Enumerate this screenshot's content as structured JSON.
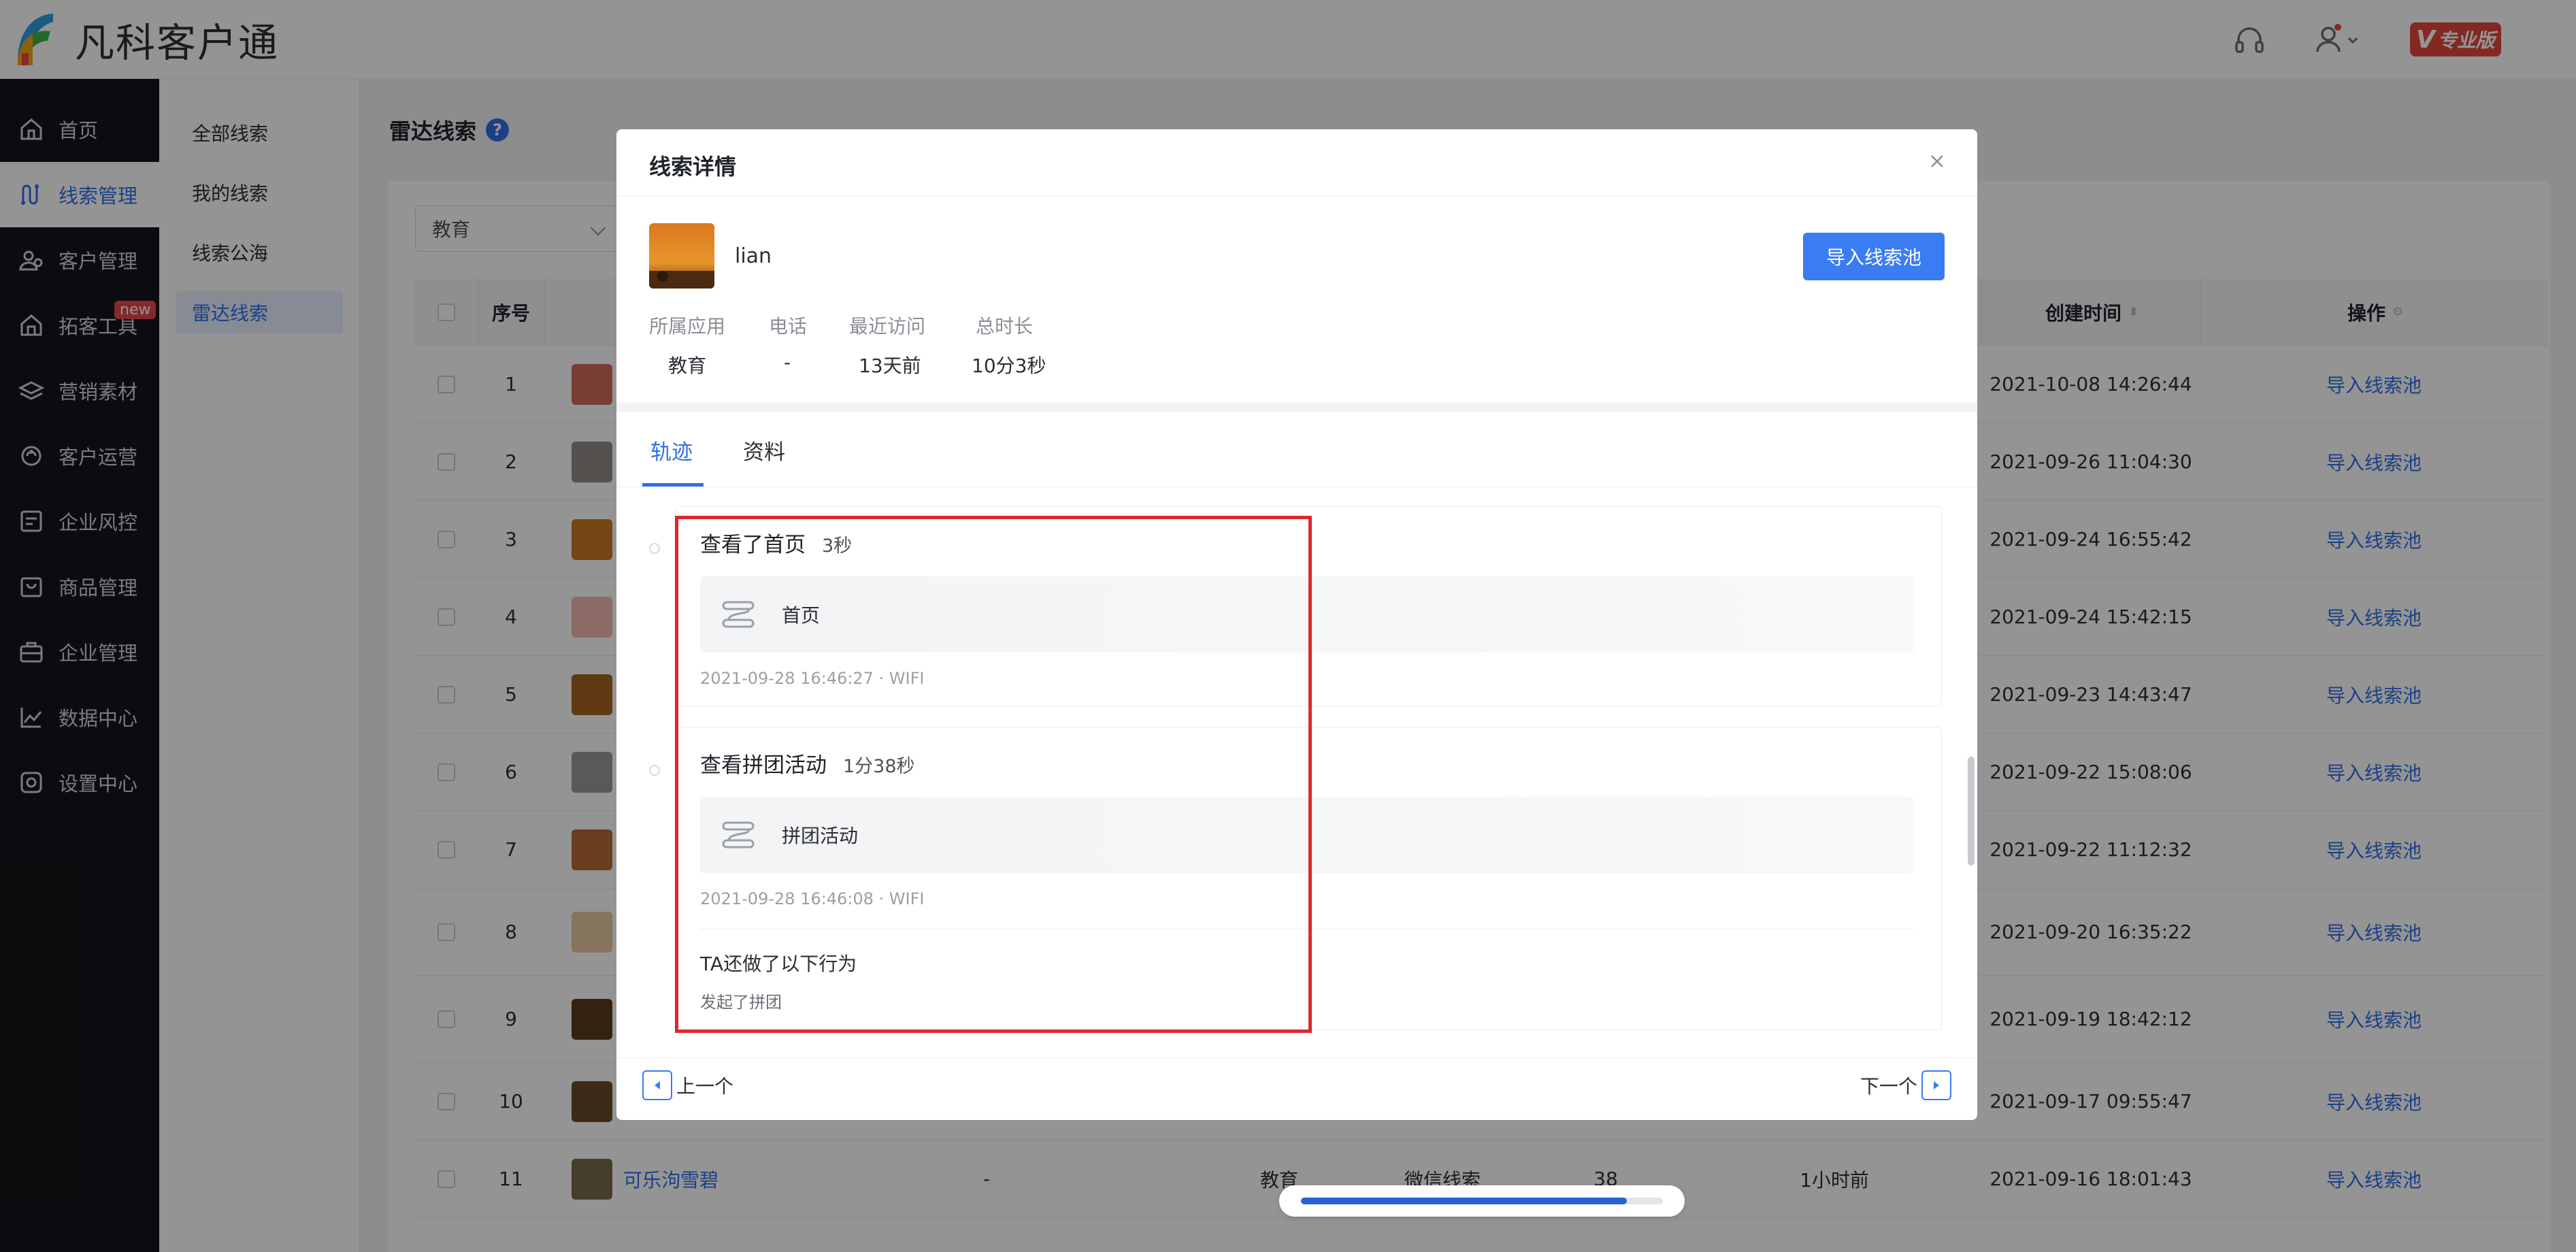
{
  "app": {
    "name": "凡科客户通",
    "edition_label": "专业版",
    "edition_letter": "V"
  },
  "sidebar": {
    "items": [
      {
        "label": "首页",
        "icon": "home-icon"
      },
      {
        "label": "线索管理",
        "icon": "leads-icon",
        "active": true
      },
      {
        "label": "客户管理",
        "icon": "customers-icon"
      },
      {
        "label": "拓客工具",
        "icon": "tools-icon",
        "badge": "new"
      },
      {
        "label": "营销素材",
        "icon": "materials-icon"
      },
      {
        "label": "客户运营",
        "icon": "operations-icon"
      },
      {
        "label": "企业风控",
        "icon": "risk-icon"
      },
      {
        "label": "商品管理",
        "icon": "products-icon"
      },
      {
        "label": "企业管理",
        "icon": "enterprise-icon"
      },
      {
        "label": "数据中心",
        "icon": "data-icon"
      },
      {
        "label": "设置中心",
        "icon": "settings-icon"
      }
    ]
  },
  "submenu": {
    "items": [
      {
        "label": "全部线索"
      },
      {
        "label": "我的线索"
      },
      {
        "label": "线索公海"
      },
      {
        "label": "雷达线索",
        "active": true
      }
    ]
  },
  "main": {
    "title": "雷达线索",
    "filter_value": "教育",
    "table": {
      "headers": {
        "index": "序号",
        "created": "创建时间",
        "actions": "操作"
      },
      "rows": [
        {
          "index": "1",
          "created": "2021-10-08 14:26:44",
          "action": "导入线索池"
        },
        {
          "index": "2",
          "created": "2021-09-26 11:04:30",
          "action": "导入线索池"
        },
        {
          "index": "3",
          "created": "2021-09-24 16:55:42",
          "action": "导入线索池"
        },
        {
          "index": "4",
          "created": "2021-09-24 15:42:15",
          "action": "导入线索池"
        },
        {
          "index": "5",
          "created": "2021-09-23 14:43:47",
          "action": "导入线索池"
        },
        {
          "index": "6",
          "created": "2021-09-22 15:08:06",
          "action": "导入线索池"
        },
        {
          "index": "7",
          "created": "2021-09-22 11:12:32",
          "action": "导入线索池"
        },
        {
          "index": "8",
          "created": "2021-09-20 16:35:22",
          "action": "导入线索池"
        },
        {
          "index": "9",
          "created": "2021-09-19 18:42:12",
          "action": "导入线索池"
        },
        {
          "index": "10",
          "created": "2021-09-17 09:55:47",
          "action": "导入线索池"
        },
        {
          "index": "11",
          "name": "可乐泃雪碧",
          "phone": "-",
          "app": "教育",
          "source": "微信线索",
          "visits": "38",
          "last_visit": "1小时前",
          "created": "2021-09-16 18:01:43",
          "action": "导入线索池"
        }
      ]
    }
  },
  "modal": {
    "title": "线索详情",
    "name": "lian",
    "import_button": "导入线索池",
    "info": [
      {
        "label": "所属应用",
        "value": "教育"
      },
      {
        "label": "电话",
        "value": "-"
      },
      {
        "label": "最近访问",
        "value": "13天前"
      },
      {
        "label": "总时长",
        "value": "10分3秒"
      }
    ],
    "tabs": [
      {
        "label": "轨迹",
        "active": true
      },
      {
        "label": "资料"
      }
    ],
    "timeline": [
      {
        "title": "查看了首页",
        "duration": "3秒",
        "page": "首页",
        "meta": "2021-09-28 16:46:27 · WIFI"
      },
      {
        "title": "查看拼团活动",
        "duration": "1分38秒",
        "page": "拼团活动",
        "meta": "2021-09-28 16:46:08 · WIFI",
        "extra_title": "TA还做了以下行为",
        "extra_text": "发起了拼团"
      }
    ],
    "prev_label": "上一个",
    "next_label": "下一个"
  },
  "upload_progress": 0.9,
  "colors": {
    "accent": "#2f6fe8",
    "sidebar_bg": "#14161a",
    "highlight": "#e0272e",
    "badge_red": "#e5484d"
  }
}
